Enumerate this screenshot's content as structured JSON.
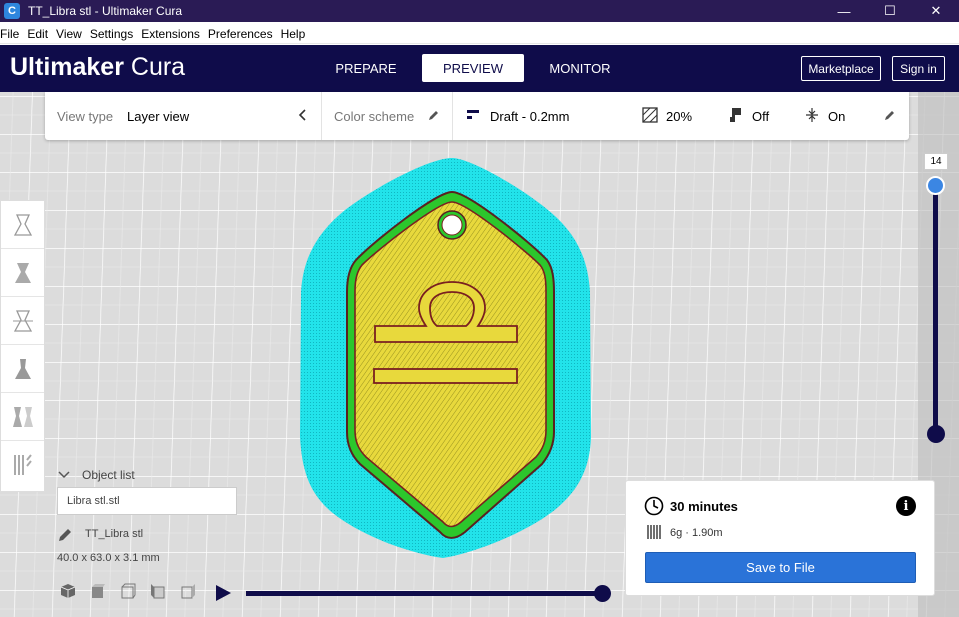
{
  "window": {
    "title": "TT_Libra stl - Ultimaker Cura",
    "app_icon": "C",
    "controls": [
      "—",
      "☐",
      "✕"
    ]
  },
  "menu": [
    "File",
    "Edit",
    "View",
    "Settings",
    "Extensions",
    "Preferences",
    "Help"
  ],
  "header": {
    "brand_bold": "Ultimaker",
    "brand_light": " Cura",
    "tabs": [
      {
        "label": "PREPARE",
        "active": false
      },
      {
        "label": "PREVIEW",
        "active": true
      },
      {
        "label": "MONITOR",
        "active": false
      }
    ],
    "marketplace_label": "Marketplace",
    "signin_label": "Sign in"
  },
  "toolbar": {
    "view_type_label": "View type",
    "view_type_value": "Layer view",
    "color_scheme_label": "Color scheme",
    "profile": "Draft - 0.2mm",
    "infill": "20%",
    "support": "Off",
    "adhesion": "On"
  },
  "layer_slider": {
    "current_layer": "14"
  },
  "object_list": {
    "header": "Object list",
    "item": "Libra stl.stl",
    "object_name": "TT_Libra stl",
    "dimensions": "40.0 x 63.0 x 3.1 mm"
  },
  "print_info": {
    "time": "30 minutes",
    "material": "6g · 1.90m",
    "save_label": "Save to File"
  },
  "colors": {
    "header_bg": "#0f0c4a",
    "accent_blue": "#2a73d8",
    "brim_cyan": "#19e0e6",
    "infill_yellow": "#e6d63a",
    "wall_red": "#c0392b",
    "wall_green": "#2fbf2f"
  }
}
